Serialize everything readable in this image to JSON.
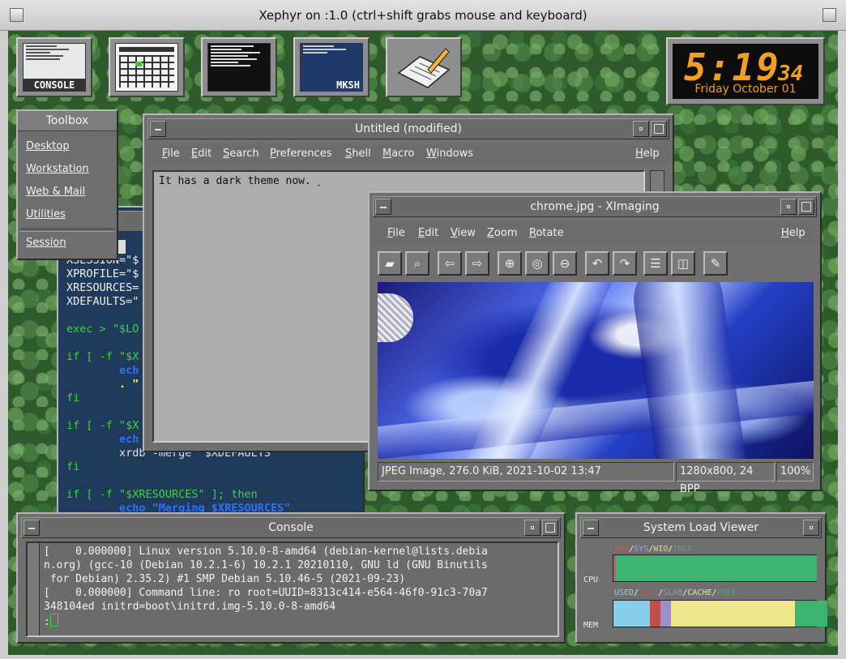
{
  "window": {
    "title": "Xephyr on :1.0 (ctrl+shift grabs mouse and keyboard)"
  },
  "icons": [
    {
      "name": "console-icon",
      "label": "CONSOLE"
    },
    {
      "name": "calendar-icon",
      "label": ""
    },
    {
      "name": "terminal-icon",
      "label": ""
    },
    {
      "name": "mksh-icon",
      "label": "MKSH"
    },
    {
      "name": "notepad-icon",
      "label": ""
    }
  ],
  "clock": {
    "hours_minutes": "5:19",
    "seconds": "34",
    "date": "Friday October 01"
  },
  "toolbox": {
    "title": "Toolbox",
    "items": [
      "Desktop",
      "Workstation",
      "Web & Mail",
      "Utilities",
      "Session"
    ]
  },
  "code": {
    "lines": [
      "ano ",
      "XSESSION=\"$",
      "XPROFILE=\"$",
      "XRESOURCES=",
      "XDEFAULTS=\"",
      "",
      "exec > \"$LO",
      "",
      "if [ -f \"$X",
      "        ech",
      "        . \"",
      "fi",
      "",
      "if [ -f \"$X",
      "        ech",
      "        xrdb -merge \"$XDEFAULTS\"",
      "fi",
      "",
      "if [ -f \"$XRESOURCES\" ]; then",
      "        echo \"Merging $XRESOURCES\""
    ]
  },
  "editor": {
    "title": "Untitled (modified)",
    "menu": [
      "File",
      "Edit",
      "Search",
      "Preferences",
      "Shell",
      "Macro",
      "Windows",
      "Help"
    ],
    "content": "It has a dark theme now."
  },
  "ximaging": {
    "title": "chrome.jpg - XImaging",
    "menu": [
      "File",
      "Edit",
      "View",
      "Zoom",
      "Rotate",
      "Help"
    ],
    "tools": [
      "open-icon",
      "browse-icon",
      "previous-icon",
      "next-icon",
      "zoom-in-icon",
      "zoom-fit-icon",
      "zoom-out-icon",
      "rotate-left-icon",
      "rotate-right-icon",
      "flip-vertical-icon",
      "flip-horizontal-icon",
      "pin-icon"
    ],
    "status": {
      "info": "JPEG Image, 276.0 KiB, 2021-10-02 13:47",
      "size": "1280x800, 24 BPP",
      "zoom": "100%"
    }
  },
  "console": {
    "title": "Console",
    "lines": [
      "[    0.000000] Linux version 5.10.0-8-amd64 (debian-kernel@lists.debia",
      "n.org) (gcc-10 (Debian 10.2.1-6) 10.2.1 20210110, GNU ld (GNU Binutils",
      " for Debian) 2.35.2) #1 SMP Debian 5.10.46-5 (2021-09-23)",
      "[    0.000000] Command line: ro root=UUID=8313c414-e564-46f0-91c3-70a7",
      "348104ed initrd=boot\\initrd.img-5.10.0-8-amd64"
    ],
    "prompt": ":"
  },
  "load": {
    "title": "System Load Viewer",
    "cpu_label": "CPU",
    "mem_label": "MEM",
    "cpu_legend": [
      "USR",
      "SYS",
      "WIO",
      "IDLE"
    ],
    "mem_legend": [
      "USED",
      "BUFF",
      "SLAB",
      "CACHE",
      "FREE"
    ],
    "cpu_colors": [
      "#e05050",
      "#9aa0ff",
      "#e0e060",
      "#3cb371"
    ],
    "mem_colors": [
      "#87ceeb",
      "#c0504d",
      "#9b8fd0",
      "#eee68c",
      "#3cb371"
    ],
    "cpu_values": [
      0.01,
      0.0,
      0.0,
      0.99
    ],
    "mem_values": [
      0.18,
      0.05,
      0.05,
      0.61,
      0.16
    ]
  }
}
